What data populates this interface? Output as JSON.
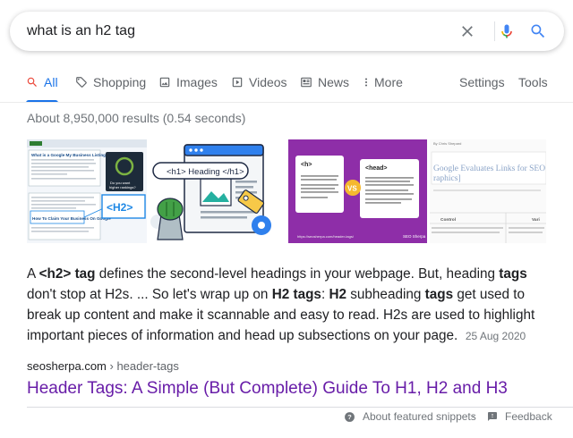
{
  "search": {
    "query": "what is an h2 tag"
  },
  "tabs": [
    {
      "label": "All",
      "icon": "search-icon"
    },
    {
      "label": "Shopping",
      "icon": "tag-icon"
    },
    {
      "label": "Images",
      "icon": "image-icon"
    },
    {
      "label": "Videos",
      "icon": "play-icon"
    },
    {
      "label": "News",
      "icon": "newspaper-icon"
    },
    {
      "label": "More",
      "icon": "more-vert-icon"
    }
  ],
  "tools": {
    "settings": "Settings",
    "tools": "Tools"
  },
  "stats": "About 8,950,000 results (0.54 seconds)",
  "images": {
    "img1": {
      "heading1": "What is a Google My Business Listing?",
      "heading2": "How To Claim Your Business On Google",
      "badge_line1": "Do you want",
      "badge_line2": "higher rankings?",
      "tag": "<H2>"
    },
    "img2": {
      "tag": "<h1> Heading </h1>"
    },
    "img3": {
      "left_tag": "<h>",
      "right_tag": "<head>",
      "vs": "VS",
      "footer_url": "https://seosherpa.com/header-tags/",
      "brand": "SEO Sherpa"
    },
    "img4": {
      "byline": "By Chris Shepard",
      "title_line1": "Google Evaluates Links for SEO",
      "title_line2": "raphics]",
      "col1": "Control",
      "col2": "Vari"
    }
  },
  "snippet": {
    "p1": "A ",
    "b1": "<h2>",
    "p2": " ",
    "b2": "tag",
    "p3": " defines the second-level headings in your webpage. But, heading ",
    "b3": "tags",
    "p4": " don't stop at H2s. ... So let's wrap up on ",
    "b4": "H2 tags",
    "p5": ": ",
    "b5": "H2",
    "p6": " subheading ",
    "b6": "tags",
    "p7": " get used to break up content and make it scannable and easy to read. H2s are used to highlight important pieces of information and head up subsections on your page.",
    "date": "25 Aug 2020"
  },
  "result": {
    "domain": "seosherpa.com",
    "path": " › header-tags",
    "title": "Header Tags: A Simple (But Complete) Guide To H1, H2 and H3"
  },
  "footer": {
    "about": "About featured snippets",
    "separator": "·",
    "feedback": "Feedback"
  },
  "colors": {
    "accent": "#1a73e8",
    "visited": "#681da8",
    "muted": "#70757a"
  }
}
